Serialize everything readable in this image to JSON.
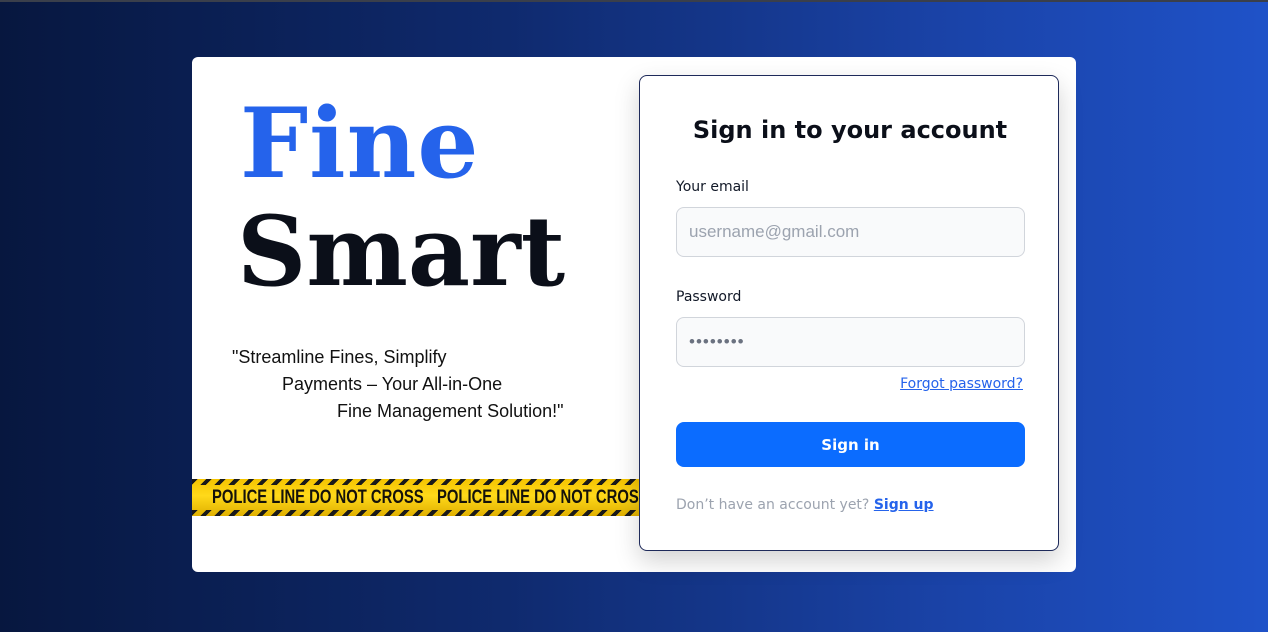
{
  "brand": {
    "word1": "Fine",
    "word2": "Smart",
    "tagline": [
      "\"Streamline Fines, Simplify",
      "Payments – Your All-in-One",
      "Fine Management Solution!\""
    ],
    "tape_text": [
      "POLICE LINE DO NOT CROSS",
      "POLICE LINE DO NOT CROSS"
    ]
  },
  "login": {
    "title": "Sign in to your account",
    "email_label": "Your email",
    "email_placeholder": "username@gmail.com",
    "email_value": "",
    "password_label": "Password",
    "password_value": "••••••••",
    "forgot_label": "Forgot password?",
    "signin_label": "Sign in",
    "signup_prompt": "Don’t have an account yet?",
    "signup_label": "Sign up"
  },
  "colors": {
    "brand_blue": "#2563eb",
    "button_blue": "#0b6cff",
    "bg_dark": "#07173f",
    "bg_light": "#1f52c8",
    "tape_yellow": "#f5c400"
  }
}
